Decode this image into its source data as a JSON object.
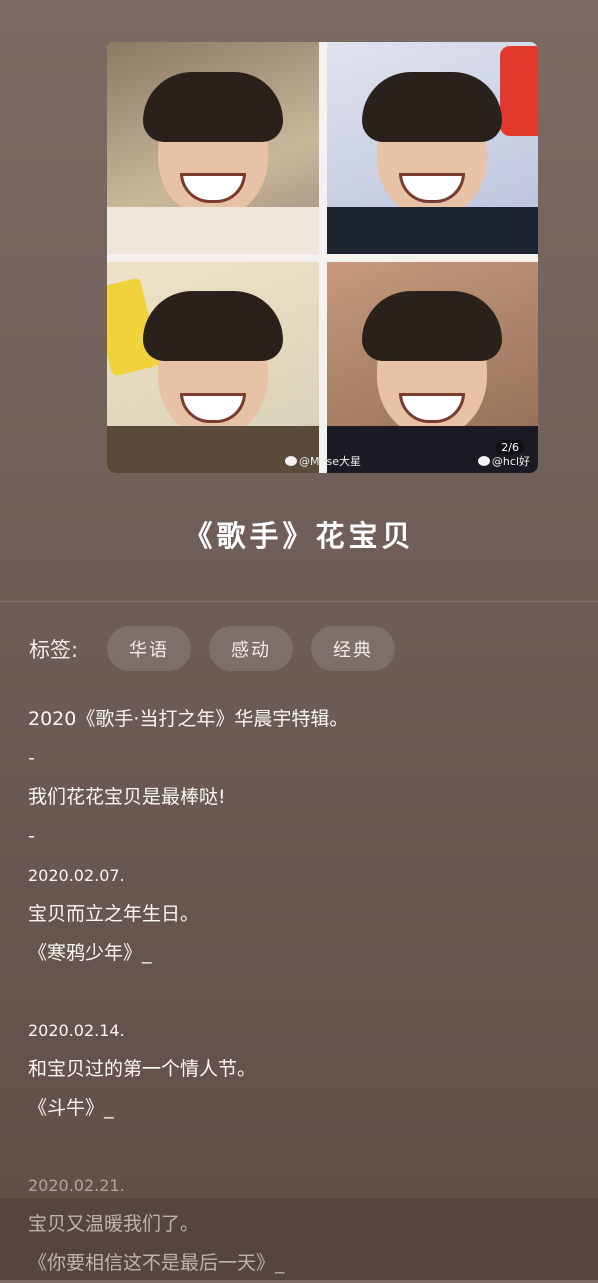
{
  "cover": {
    "watermarks": [
      "@Muse大星",
      "@hcl好"
    ],
    "page_indicator": "2/6"
  },
  "title": "《歌手》花宝贝",
  "tags": {
    "label": "标签:",
    "items": [
      "华语",
      "感动",
      "经典"
    ]
  },
  "description": {
    "lines": [
      "2020《歌手·当打之年》华晨宇特辑。",
      "-",
      "我们花花宝贝是最棒哒!",
      "-",
      "2020.02.07.",
      "宝贝而立之年生日。",
      "《寒鸦少年》_",
      "",
      "2020.02.14.",
      "和宝贝过的第一个情人节。",
      "《斗牛》_",
      "",
      "2020.02.21.",
      "宝贝又温暖我们了。",
      "《你要相信这不是最后一天》_"
    ]
  }
}
